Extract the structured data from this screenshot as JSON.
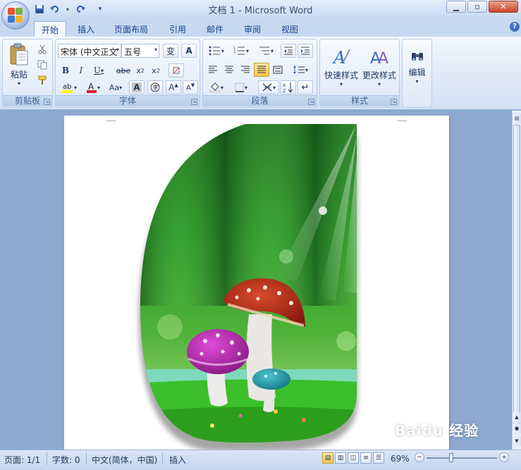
{
  "window": {
    "title": "文档 1 - Microsoft Word"
  },
  "tabs": [
    "开始",
    "插入",
    "页面布局",
    "引用",
    "邮件",
    "审阅",
    "视图"
  ],
  "ribbon": {
    "clipboard": {
      "paste_label": "粘贴",
      "group_label": "剪贴板"
    },
    "font": {
      "font_name": "宋体 (中文正文",
      "font_size": "五号",
      "group_label": "字体",
      "wen_glyph": "变",
      "big_a": "A",
      "aa_label": "Aa"
    },
    "paragraph": {
      "group_label": "段落"
    },
    "styles": {
      "quick_styles_label": "快速样式",
      "change_styles_label": "更改样式",
      "group_label": "样式"
    },
    "editing": {
      "edit_label": "编辑"
    }
  },
  "statusbar": {
    "page": "页面: 1/1",
    "words": "字数: 0",
    "language": "中文(简体，中国)",
    "mode": "插入",
    "zoom": "69%"
  },
  "watermark": {
    "text": "Baidu 经验"
  },
  "colors": {
    "accent": "#15428b",
    "ribbon_bg": "#dfe9f7",
    "doc_bg": "#8da9cf"
  }
}
